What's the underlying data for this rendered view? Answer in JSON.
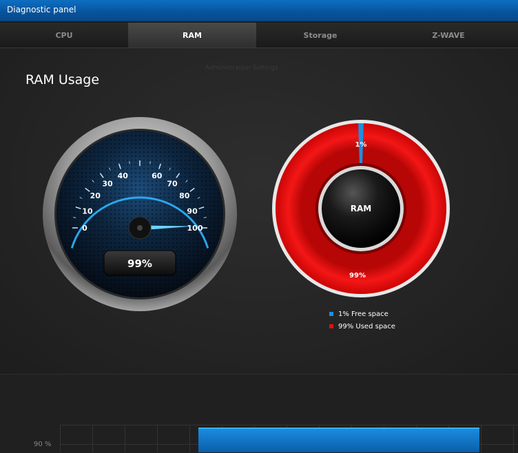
{
  "window": {
    "title": "Diagnostic panel"
  },
  "tabs": [
    {
      "label": "CPU",
      "active": false
    },
    {
      "label": "RAM",
      "active": true
    },
    {
      "label": "Storage",
      "active": false
    },
    {
      "label": "Z-WAVE",
      "active": false
    }
  ],
  "section": {
    "title": "RAM Usage",
    "ghost": "Administration Settings"
  },
  "gauge": {
    "value": 99,
    "min": 0,
    "max": 100,
    "ticks": [
      "0",
      "10",
      "20",
      "30",
      "40",
      "60",
      "70",
      "80",
      "90",
      "100"
    ],
    "readout": "99%",
    "accent": "#2fb4ff"
  },
  "donut": {
    "center_label": "RAM",
    "free_pct": 1,
    "used_pct": 99,
    "free_label": "1%",
    "used_label": "99%",
    "free_color": "#1e8fe0",
    "used_color": "#e01010"
  },
  "legend": [
    {
      "label": "1% Free space",
      "color": "#1e8fe0"
    },
    {
      "label": "99% Used space",
      "color": "#e01010"
    }
  ],
  "history": {
    "ylabel": "90 %",
    "usage": 99
  }
}
